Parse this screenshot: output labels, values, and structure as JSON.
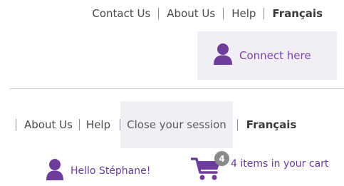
{
  "top_nav": {
    "contact": "Contact Us",
    "about": "About Us",
    "help": "Help",
    "language": "Français"
  },
  "connect": {
    "label": "Connect here",
    "icon": "person-icon"
  },
  "session_nav": {
    "about": "About Us",
    "help": "Help",
    "close_session": "Close your session",
    "language": "Français"
  },
  "greeting": {
    "label": "Hello Stéphane!",
    "icon": "person-icon"
  },
  "cart": {
    "count": "4",
    "label": "4 items in your cart",
    "icon": "shopping-cart-icon"
  },
  "colors": {
    "accent": "#7744aa",
    "highlight_bg": "#f2eef6",
    "badge": "#8a8a8a"
  }
}
